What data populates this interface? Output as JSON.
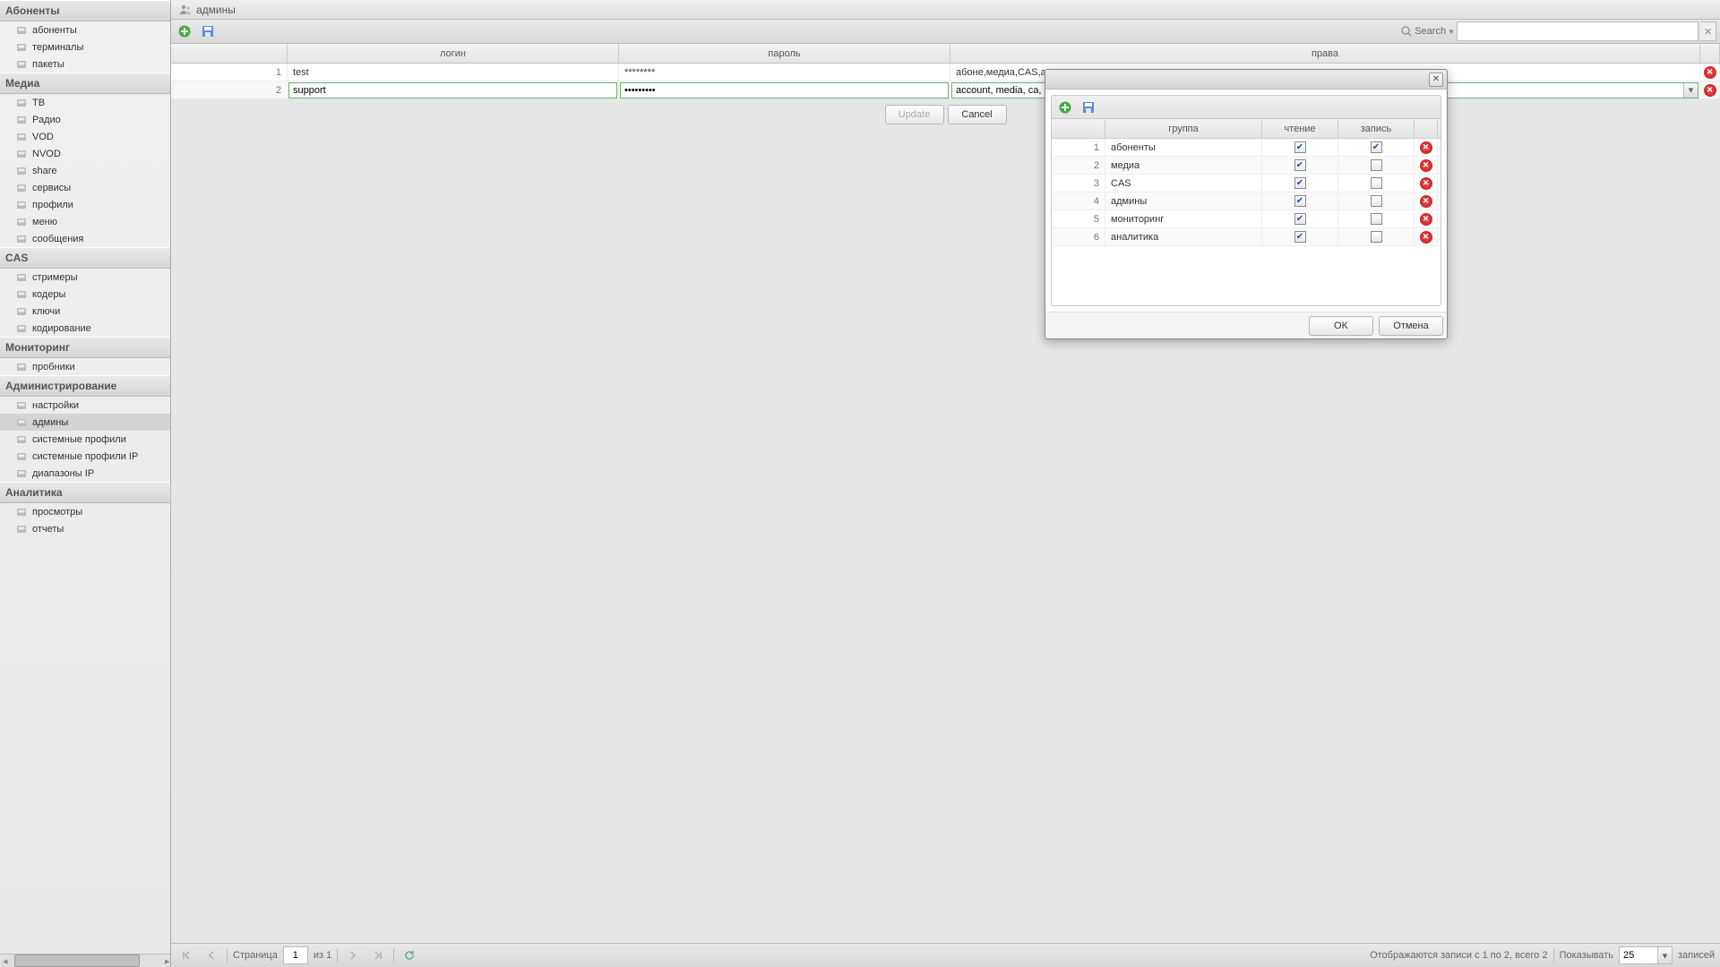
{
  "sidebar": {
    "sections": [
      {
        "title": "Абоненты",
        "items": [
          {
            "label": "абоненты",
            "icon": "user"
          },
          {
            "label": "терминалы",
            "icon": "terminal"
          },
          {
            "label": "пакеты",
            "icon": "package"
          }
        ]
      },
      {
        "title": "Медиа",
        "items": [
          {
            "label": "ТВ",
            "icon": "tv"
          },
          {
            "label": "Радио",
            "icon": "radio"
          },
          {
            "label": "VOD",
            "icon": "vod"
          },
          {
            "label": "NVOD",
            "icon": "nvod"
          },
          {
            "label": "share",
            "icon": "share"
          },
          {
            "label": "сервисы",
            "icon": "services"
          },
          {
            "label": "профили",
            "icon": "profile"
          },
          {
            "label": "меню",
            "icon": "menu"
          },
          {
            "label": "сообщения",
            "icon": "msg"
          }
        ]
      },
      {
        "title": "CAS",
        "items": [
          {
            "label": "стримеры",
            "icon": "stream"
          },
          {
            "label": "кодеры",
            "icon": "coder"
          },
          {
            "label": "ключи",
            "icon": "key"
          },
          {
            "label": "кодирование",
            "icon": "encode"
          }
        ]
      },
      {
        "title": "Мониторинг",
        "items": [
          {
            "label": "пробники",
            "icon": "probe"
          }
        ]
      },
      {
        "title": "Администрирование",
        "items": [
          {
            "label": "настройки",
            "icon": "settings"
          },
          {
            "label": "админы",
            "icon": "admin",
            "selected": true
          },
          {
            "label": "системные профили",
            "icon": "sysprof"
          },
          {
            "label": "системные профили IP",
            "icon": "sysprofip"
          },
          {
            "label": "диапазоны IP",
            "icon": "iprange"
          }
        ]
      },
      {
        "title": "Аналитика",
        "items": [
          {
            "label": "просмотры",
            "icon": "views"
          },
          {
            "label": "отчеты",
            "icon": "reports"
          }
        ]
      }
    ]
  },
  "page": {
    "title": "админы",
    "search_label": "Search",
    "search_value": "",
    "columns": {
      "login": "логин",
      "password": "пароль",
      "rights": "права"
    },
    "rows": [
      {
        "n": "1",
        "login": "test",
        "password": "********",
        "rights": "абоне,медиа,CAS,админ,монит,анали",
        "editing": false
      },
      {
        "n": "2",
        "login": "support",
        "password": "•••••••••",
        "rights": "account, media, ca, admin, monitoring, analytics",
        "editing": true
      }
    ],
    "edit_actions": {
      "update": "Update",
      "cancel": "Cancel"
    }
  },
  "popup": {
    "columns": {
      "group": "группа",
      "read": "чтение",
      "write": "запись"
    },
    "rows": [
      {
        "n": "1",
        "group": "абоненты",
        "read": true,
        "write": true
      },
      {
        "n": "2",
        "group": "медиа",
        "read": true,
        "write": false
      },
      {
        "n": "3",
        "group": "CAS",
        "read": true,
        "write": false
      },
      {
        "n": "4",
        "group": "админы",
        "read": true,
        "write": false
      },
      {
        "n": "5",
        "group": "мониторинг",
        "read": true,
        "write": false
      },
      {
        "n": "6",
        "group": "аналитика",
        "read": true,
        "write": false
      }
    ],
    "ok": "OK",
    "cancel": "Отмена"
  },
  "status": {
    "page_label": "Страница",
    "page": "1",
    "of_label": "из 1",
    "summary": "Отображаются записи с 1 по 2, всего 2",
    "show_label": "Показывать",
    "show_value": "25",
    "records_label": "записей"
  }
}
